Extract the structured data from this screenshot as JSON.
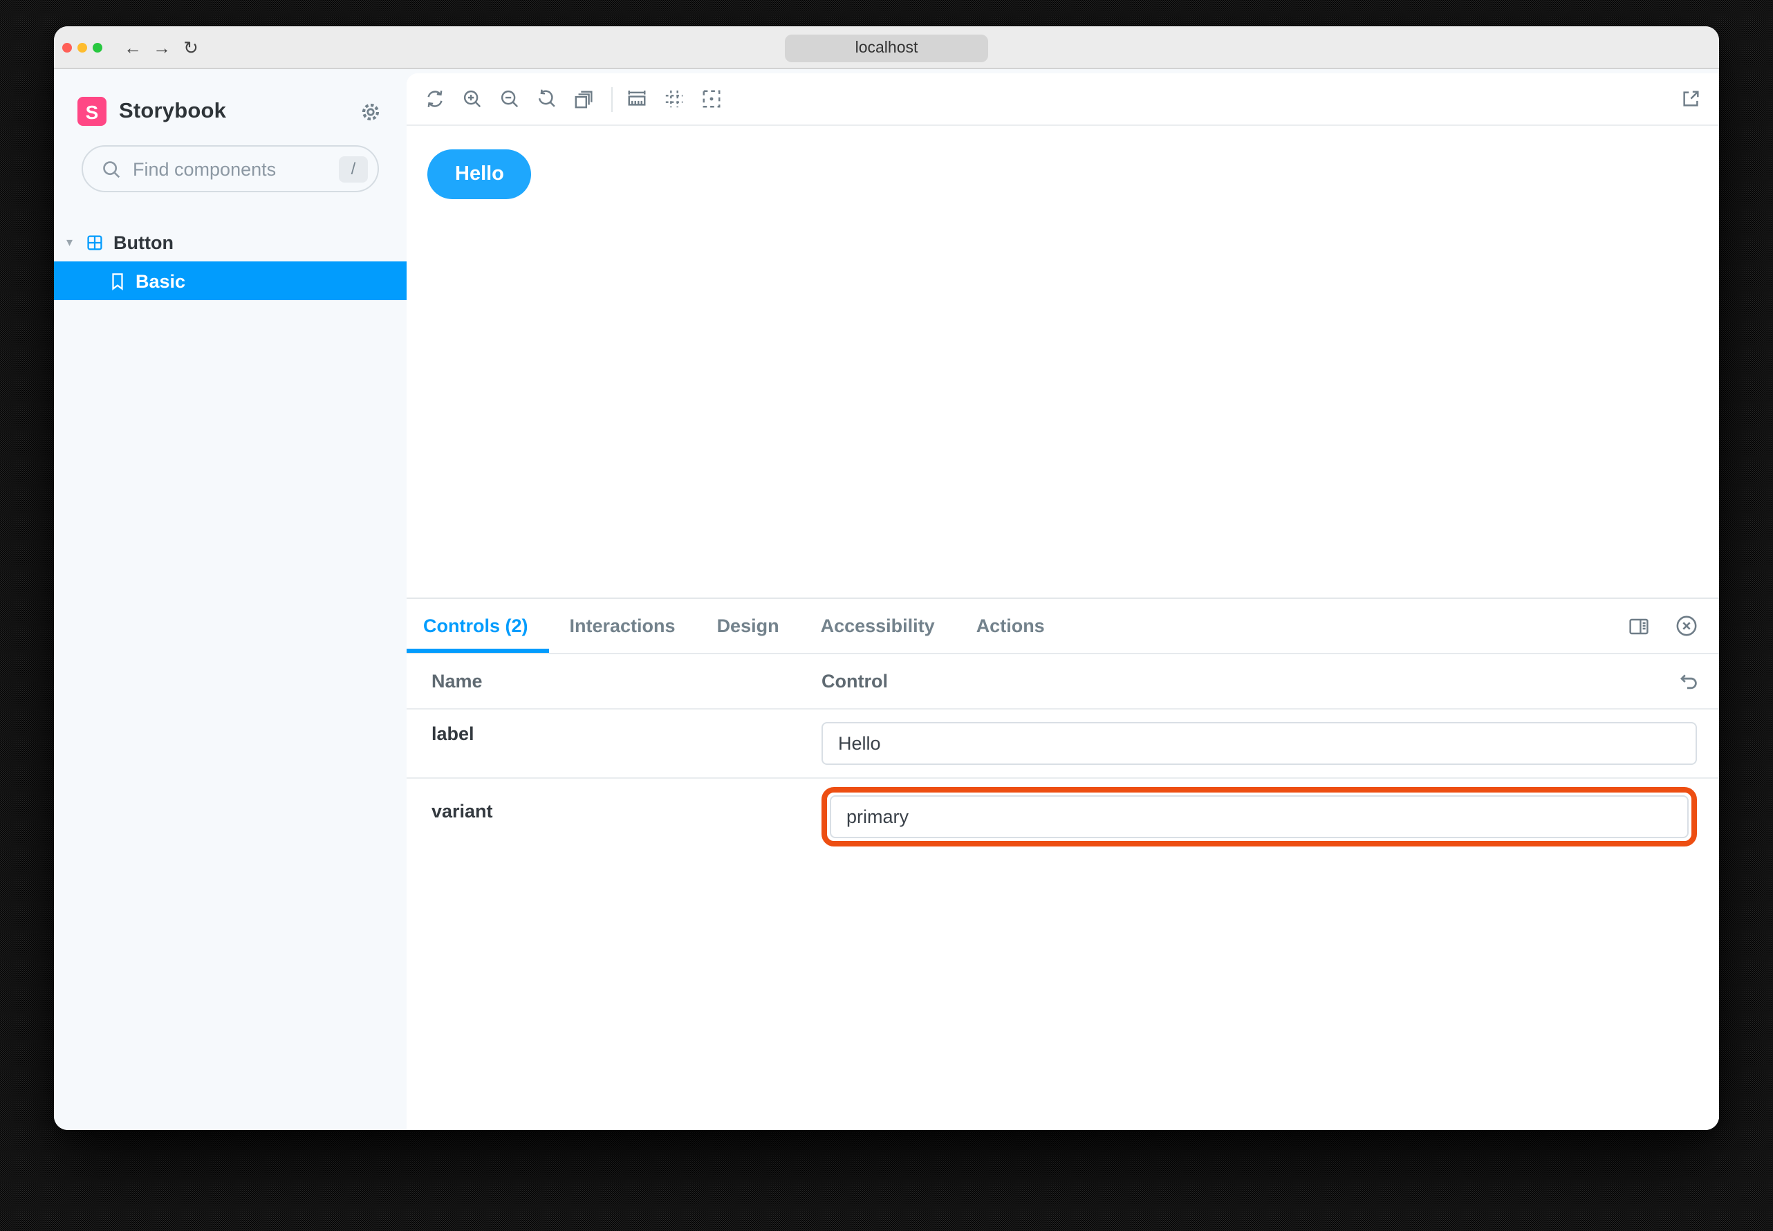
{
  "browser": {
    "url": "localhost",
    "icons": {
      "back": "←",
      "forward": "→",
      "reload": "↻"
    }
  },
  "sidebar": {
    "brand": "Storybook",
    "logo_letter": "S",
    "search": {
      "placeholder": "Find components",
      "shortcut": "/"
    },
    "tree": {
      "component": {
        "label": "Button",
        "caret": "▾"
      },
      "story": {
        "label": "Basic",
        "selected": true
      }
    }
  },
  "canvas_toolbar": {
    "icons": [
      "remount",
      "zoom-in",
      "zoom-out",
      "zoom-reset",
      "backgrounds",
      "measure",
      "grid",
      "outline",
      "open-external"
    ]
  },
  "preview": {
    "button_label": "Hello"
  },
  "panel": {
    "tabs": [
      {
        "label": "Controls (2)",
        "active": true
      },
      {
        "label": "Interactions",
        "active": false
      },
      {
        "label": "Design",
        "active": false
      },
      {
        "label": "Accessibility",
        "active": false
      },
      {
        "label": "Actions",
        "active": false
      }
    ],
    "table": {
      "headers": [
        "Name",
        "Control"
      ],
      "rows": [
        {
          "name": "label",
          "value": "Hello",
          "highlighted": false
        },
        {
          "name": "variant",
          "value": "primary",
          "highlighted": true
        }
      ]
    }
  },
  "colors": {
    "accent": "#029CFD",
    "button": "#1EA7FD",
    "highlight": "#ED4E12",
    "brand": "#FF4785",
    "app_bg": "#F6F9FC"
  }
}
